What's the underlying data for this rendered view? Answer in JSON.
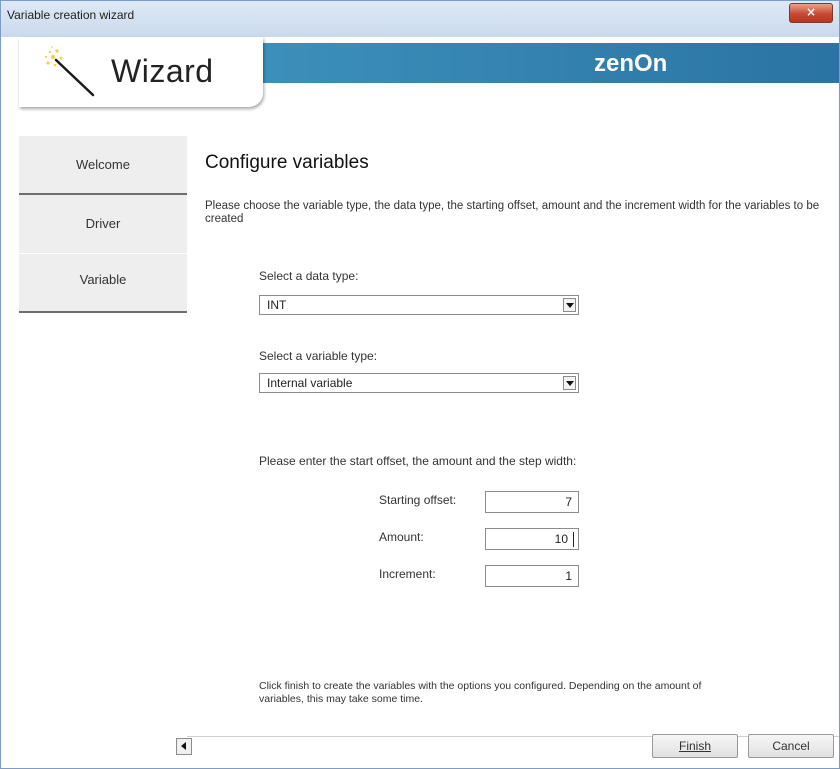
{
  "window": {
    "title": "Variable creation wizard",
    "close_symbol": "×"
  },
  "header": {
    "wizard_label": "Wizard",
    "brand": "zenOn",
    "icon": "magic-wand-icon",
    "accent_color": "#2f7fb0"
  },
  "sidebar": {
    "items": [
      {
        "label": "Welcome"
      },
      {
        "label": "Driver"
      },
      {
        "label": "Variable"
      }
    ]
  },
  "main": {
    "heading": "Configure variables",
    "intro": "Please choose the variable type, the data type, the starting offset, amount and the increment width for the variables to be created",
    "data_type": {
      "label": "Select a data type:",
      "value": "INT"
    },
    "variable_type": {
      "label": "Select a variable type:",
      "value": "Internal variable"
    },
    "offsets_prompt": "Please enter the start offset, the amount and the step width:",
    "fields": {
      "starting_offset": {
        "label": "Starting offset:",
        "value": "7"
      },
      "amount": {
        "label": "Amount:",
        "value": "10"
      },
      "increment": {
        "label": "Increment:",
        "value": "1"
      }
    },
    "footnote": "Click finish to create the variables with the options you configured. Depending on the amount of variables, this may take some time."
  },
  "footer": {
    "finish_label": "Finish",
    "cancel_label": "Cancel"
  }
}
